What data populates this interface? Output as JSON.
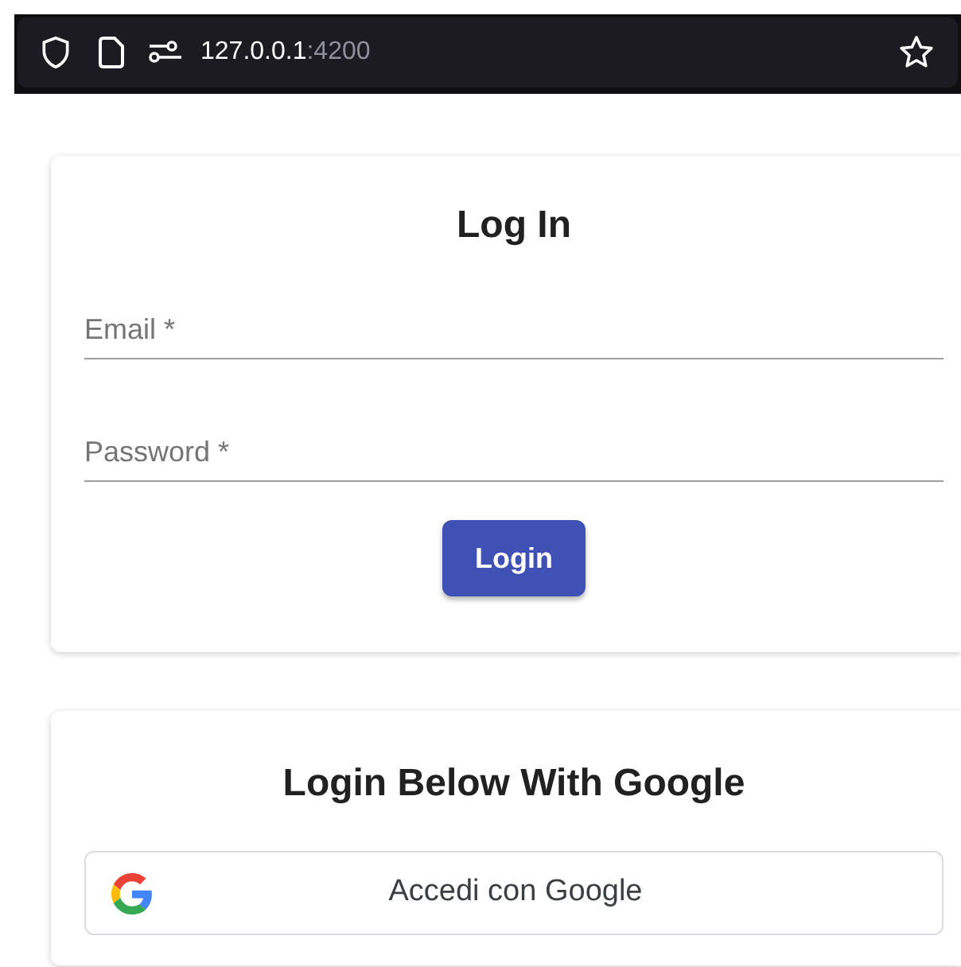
{
  "address_bar": {
    "host": "127.0.0.1",
    "port": ":4200"
  },
  "login_card": {
    "title": "Log In",
    "fields": [
      {
        "placeholder": "Email *"
      },
      {
        "placeholder": "Password *"
      }
    ],
    "button": "Login"
  },
  "google_card": {
    "title": "Login Below With Google",
    "button": "Accedi con Google"
  }
}
